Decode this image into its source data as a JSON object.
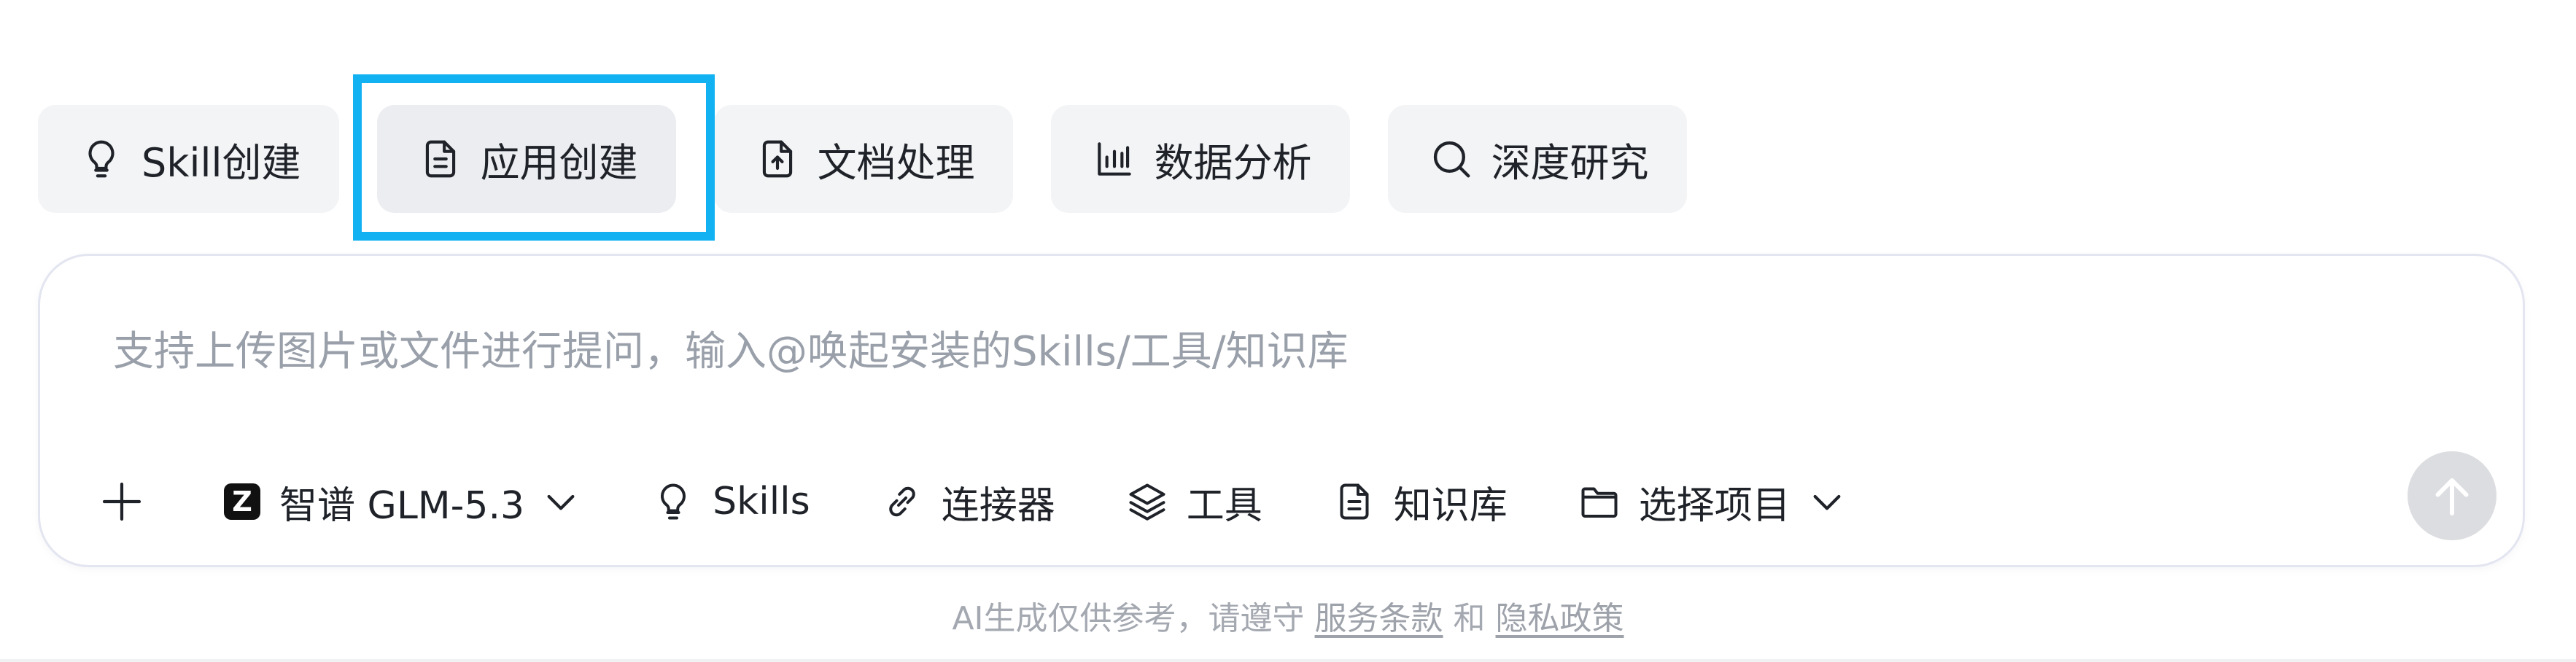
{
  "quick_actions": [
    {
      "label": "Skill创建",
      "icon": "lightbulb-icon"
    },
    {
      "label": "应用创建",
      "icon": "document-icon"
    },
    {
      "label": "文档处理",
      "icon": "file-upload-icon"
    },
    {
      "label": "数据分析",
      "icon": "bar-chart-icon"
    },
    {
      "label": "深度研究",
      "icon": "search-icon"
    }
  ],
  "selected_quick_action": "应用创建",
  "input": {
    "placeholder": "支持上传图片或文件进行提问，输入@唤起安装的Skills/工具/知识库"
  },
  "toolbar": {
    "model_logo": "Z",
    "model_name": "智谱 GLM-5.3",
    "skills_label": "Skills",
    "connector_label": "连接器",
    "tools_label": "工具",
    "knowledge_label": "知识库",
    "project_label": "选择项目"
  },
  "footer": {
    "prefix": "AI生成仅供参考，请遵守",
    "terms_link": "服务条款",
    "and": "和",
    "privacy_link": "隐私政策"
  },
  "colors": {
    "highlight_border": "#12b1f2",
    "chip_bg": "#f3f4f6",
    "send_btn_disabled": "#dcdde0",
    "placeholder_text": "#9aa0aa"
  }
}
